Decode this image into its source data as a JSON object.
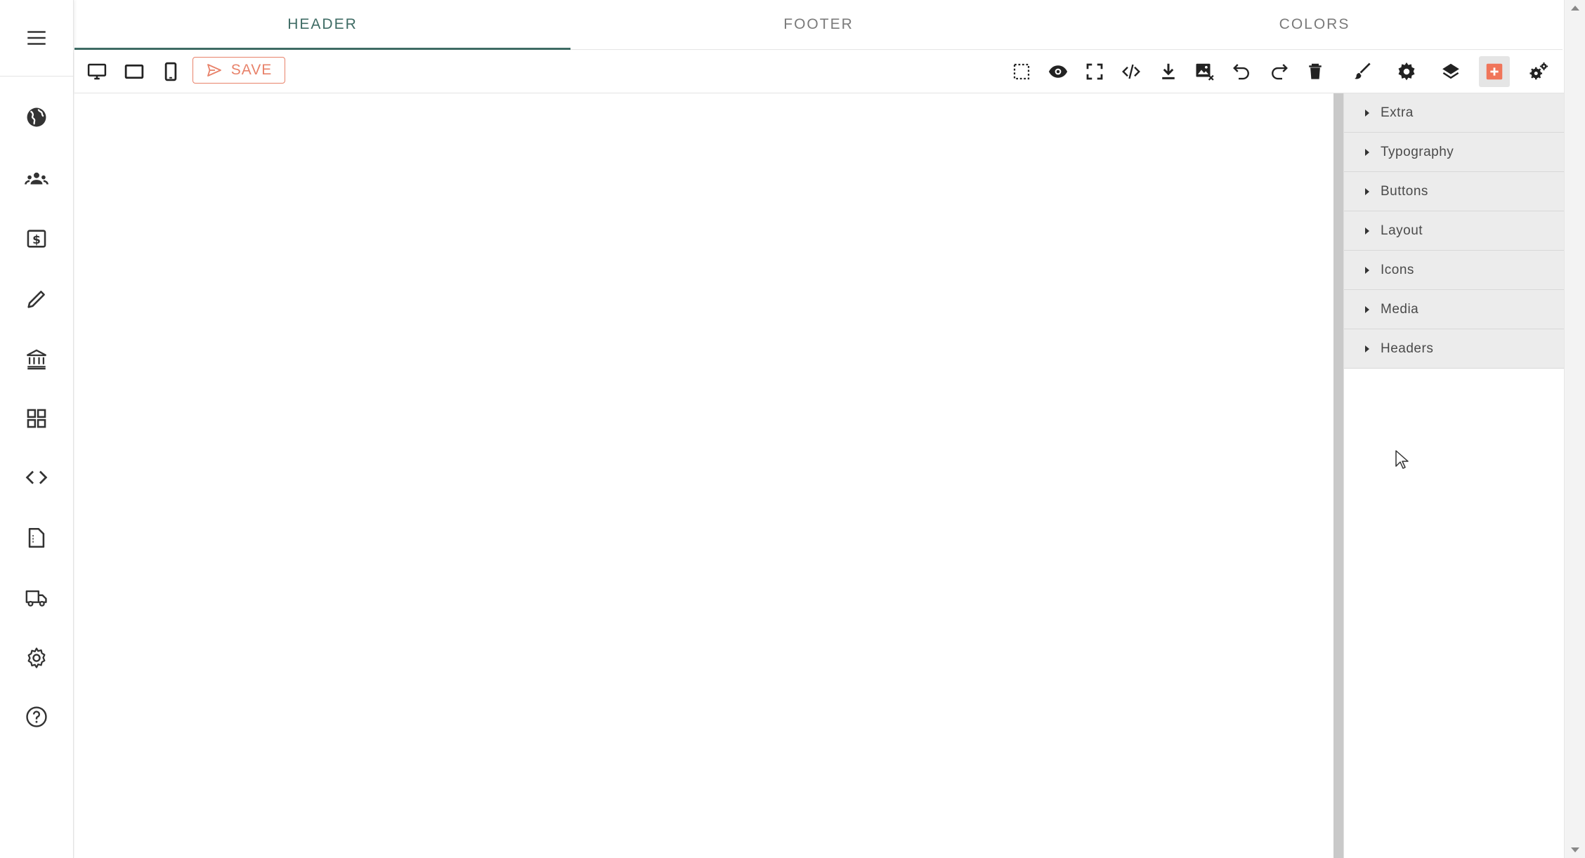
{
  "tabs": [
    {
      "label": "HEADER",
      "active": true
    },
    {
      "label": "FOOTER",
      "active": false
    },
    {
      "label": "COLORS",
      "active": false
    }
  ],
  "sidebar": {
    "items": [
      {
        "icon": "globe-icon"
      },
      {
        "icon": "users-icon"
      },
      {
        "icon": "dollar-box-icon"
      },
      {
        "icon": "pencil-icon"
      },
      {
        "icon": "bank-icon"
      },
      {
        "icon": "dashboard-grid-icon"
      },
      {
        "icon": "code-icon"
      },
      {
        "icon": "file-document-icon"
      },
      {
        "icon": "truck-icon"
      },
      {
        "icon": "gear-icon"
      },
      {
        "icon": "help-circle-icon"
      }
    ]
  },
  "toolbar": {
    "device_icons": [
      "desktop-icon",
      "tablet-icon",
      "mobile-icon"
    ],
    "save_label": "SAVE",
    "actions": [
      "select-outline-icon",
      "eye-icon",
      "fullscreen-icon",
      "code-tags-icon",
      "download-icon",
      "image-remove-icon",
      "undo-icon",
      "redo-icon",
      "trash-icon"
    ],
    "panel_buttons": [
      "brush-icon",
      "settings-icon",
      "layers-icon",
      "add-block-icon",
      "settings-cogs-icon"
    ]
  },
  "blocks_panel": {
    "categories": [
      "Extra",
      "Typography",
      "Buttons",
      "Layout",
      "Icons",
      "Media",
      "Headers"
    ]
  },
  "colors": {
    "accent": "#3e6b64",
    "save": "#e8826a",
    "add_block": "#f0755a"
  }
}
